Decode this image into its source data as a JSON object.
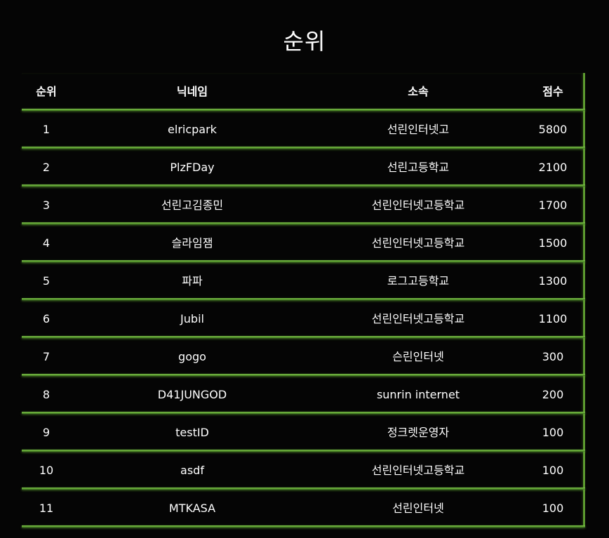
{
  "title": "순위",
  "header": {
    "rank": "순위",
    "nickname": "닉네임",
    "affiliation": "소속",
    "score": "점수"
  },
  "rows": [
    {
      "rank": "1",
      "nickname": "elricpark",
      "affiliation": "선린인터넷고",
      "score": "5800"
    },
    {
      "rank": "2",
      "nickname": "PlzFDay",
      "affiliation": "선린고등학교",
      "score": "2100"
    },
    {
      "rank": "3",
      "nickname": "선린고김종민",
      "affiliation": "선린인터넷고등학교",
      "score": "1700"
    },
    {
      "rank": "4",
      "nickname": "슬라임잼",
      "affiliation": "선린인터넷고등학교",
      "score": "1500"
    },
    {
      "rank": "5",
      "nickname": "파파",
      "affiliation": "로그고등학교",
      "score": "1300"
    },
    {
      "rank": "6",
      "nickname": "Jubil",
      "affiliation": "선린인터넷고등학교",
      "score": "1100"
    },
    {
      "rank": "7",
      "nickname": "gogo",
      "affiliation": "슨린인터넷",
      "score": "300"
    },
    {
      "rank": "8",
      "nickname": "D41JUNGOD",
      "affiliation": "sunrin internet",
      "score": "200"
    },
    {
      "rank": "9",
      "nickname": "testID",
      "affiliation": "정크렛운영자",
      "score": "100"
    },
    {
      "rank": "10",
      "nickname": "asdf",
      "affiliation": "선린인터넷고등학교",
      "score": "100"
    },
    {
      "rank": "11",
      "nickname": "MTKASA",
      "affiliation": "선린인터넷",
      "score": "100"
    }
  ],
  "colors": {
    "background": "#050505",
    "accent": "#5c9a2f",
    "text": "#ffffff"
  }
}
